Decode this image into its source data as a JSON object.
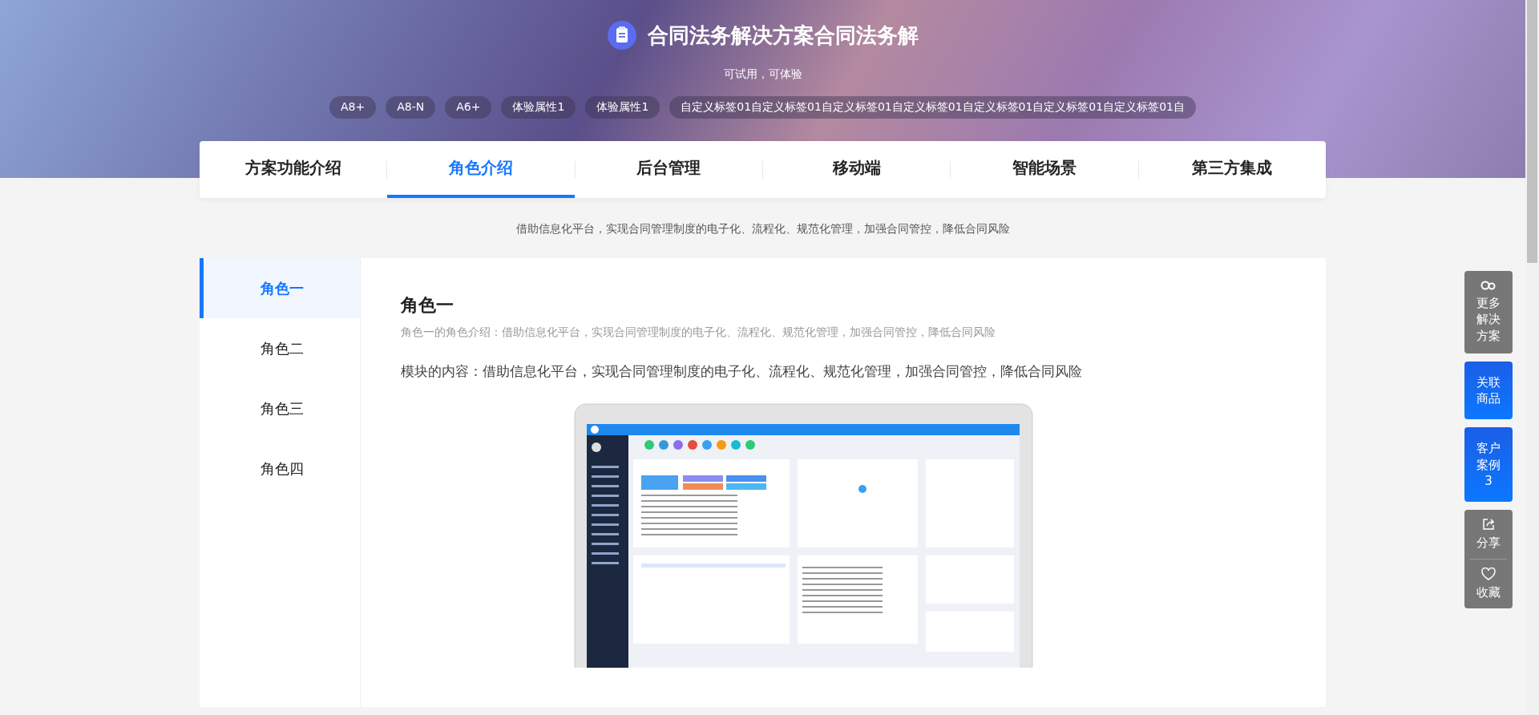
{
  "banner": {
    "title": "合同法务解决方案合同法务解",
    "subtitle": "可试用，可体验",
    "tags": [
      "A8+",
      "A8-N",
      "A6+",
      "体验属性1",
      "体验属性1",
      "自定义标签01自定义标签01自定义标签01自定义标签01自定义标签01自定义标签01自定义标签01自"
    ]
  },
  "tabs": [
    {
      "label": "方案功能介绍",
      "selected": false
    },
    {
      "label": "角色介绍",
      "selected": true
    },
    {
      "label": "后台管理",
      "selected": false
    },
    {
      "label": "移动端",
      "selected": false
    },
    {
      "label": "智能场景",
      "selected": false
    },
    {
      "label": "第三方集成",
      "selected": false
    }
  ],
  "intro": "借助信息化平台，实现合同管理制度的电子化、流程化、规范化管理，加强合同管控，降低合同风险",
  "roles": [
    {
      "label": "角色一",
      "selected": true
    },
    {
      "label": "角色二",
      "selected": false
    },
    {
      "label": "角色三",
      "selected": false
    },
    {
      "label": "角色四",
      "selected": false
    }
  ],
  "content": {
    "heading": "角色一",
    "description": "角色一的角色介绍：借助信息化平台，实现合同管理制度的电子化、流程化、规范化管理，加强合同管控，降低合同风险",
    "body": "模块的内容：借助信息化平台，实现合同管理制度的电子化、流程化、规范化管理，加强合同管控，降低合同风险"
  },
  "side_actions": [
    {
      "kind": "more",
      "label": "更多解决方案"
    },
    {
      "kind": "highlight",
      "label": "关联商品"
    },
    {
      "kind": "highlight",
      "label": "客户案例",
      "count": "3"
    },
    {
      "kind": "pair",
      "items": [
        {
          "kind": "share",
          "label": "分享"
        },
        {
          "kind": "favorite",
          "label": "收藏"
        }
      ]
    }
  ]
}
